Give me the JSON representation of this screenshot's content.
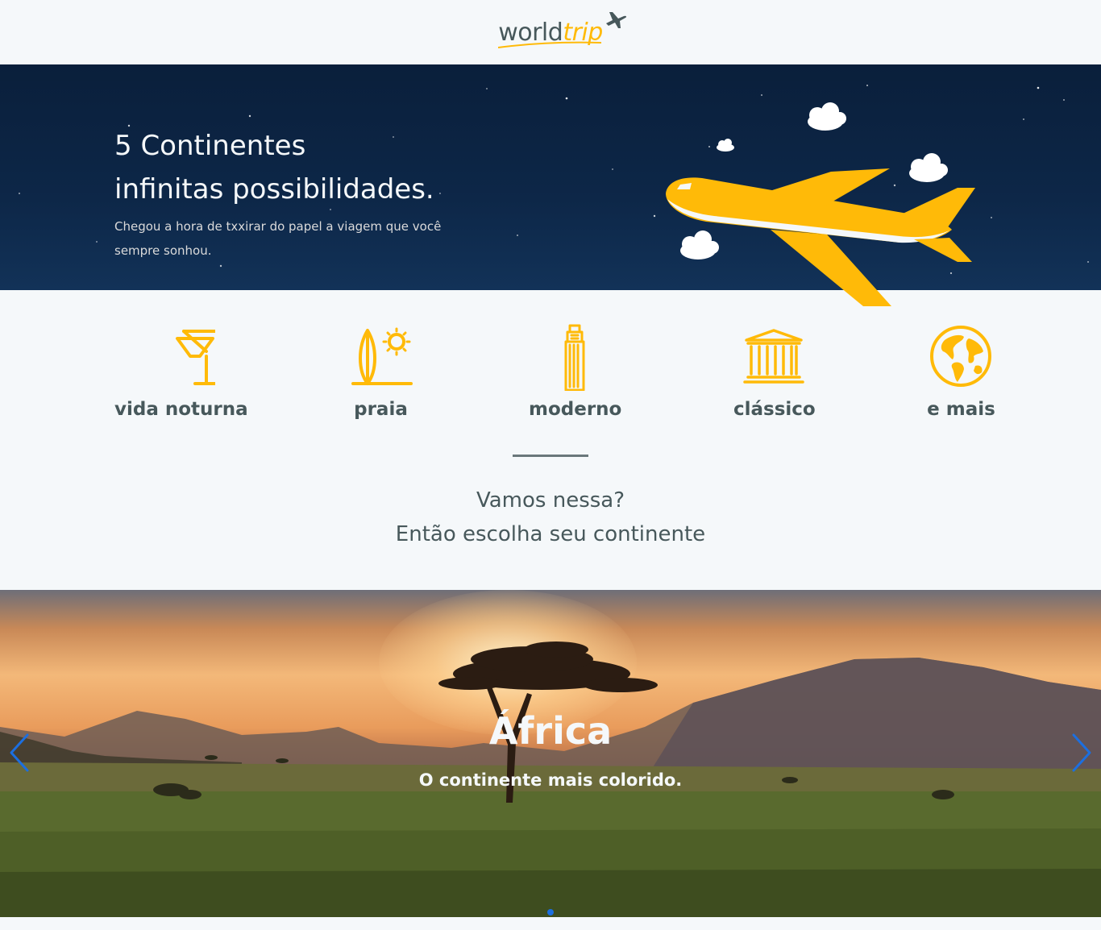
{
  "header": {
    "logo_world": "world",
    "logo_trip": "trip",
    "logo_icon": "airplane-icon"
  },
  "banner": {
    "title_line1": "5 Continentes",
    "title_line2": "infinitas possibilidades.",
    "subtitle": "Chegou a hora de txxirar do papel a viagem que você sempre sonhou.",
    "illustration": "airplane-illustration"
  },
  "types": [
    {
      "label": "vida noturna",
      "icon": "cocktail-icon"
    },
    {
      "label": "praia",
      "icon": "surfboard-sun-icon"
    },
    {
      "label": "moderno",
      "icon": "skyscraper-icon"
    },
    {
      "label": "clássico",
      "icon": "museum-icon"
    },
    {
      "label": "e mais",
      "icon": "globe-icon"
    }
  ],
  "cta": {
    "line1": "Vamos nessa?",
    "line2": "Então escolha seu continente"
  },
  "slider": {
    "slides": [
      {
        "title": "África",
        "subtitle": "O continente mais colorido."
      }
    ],
    "active_index": 0
  },
  "colors": {
    "highlight": "#ffba08",
    "dark_text": "#47585b",
    "light_text": "#f5f8fa",
    "background": "#f5f8fa",
    "banner_bg": "#0d2748",
    "slider_control": "#1c6fe0"
  }
}
